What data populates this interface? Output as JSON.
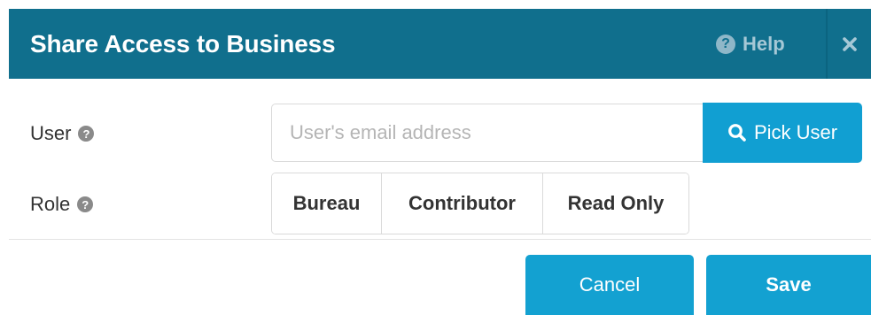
{
  "dialog": {
    "title": "Share Access to Business",
    "help_label": "Help",
    "close_icon": "close-icon",
    "colors": {
      "header_bg": "#106f8d",
      "accent": "#13a1d1"
    }
  },
  "form": {
    "user": {
      "label": "User",
      "help_icon": "question-circle-icon",
      "input_value": "",
      "input_placeholder": "User's email address",
      "pick_button_label": "Pick User",
      "pick_button_icon": "search-icon"
    },
    "role": {
      "label": "Role",
      "help_icon": "question-circle-icon",
      "options": [
        "Bureau",
        "Contributor",
        "Read Only"
      ]
    }
  },
  "footer": {
    "cancel_label": "Cancel",
    "save_label": "Save"
  }
}
